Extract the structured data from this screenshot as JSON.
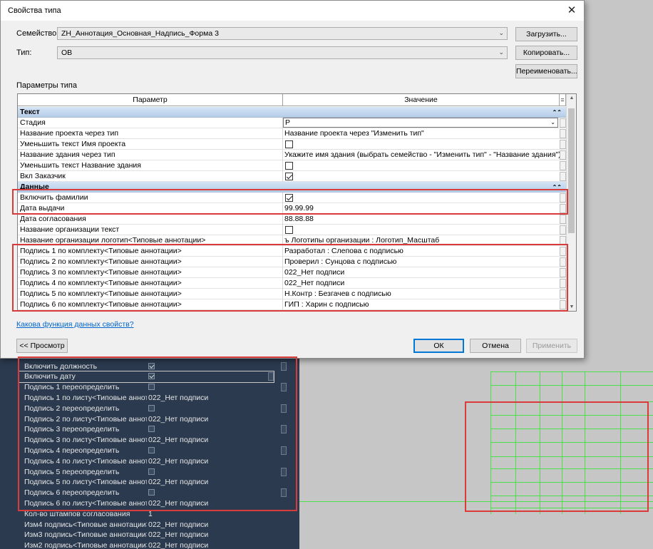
{
  "dialog": {
    "title": "Свойства типа",
    "close_label": "✕",
    "family_label": "Семейство:",
    "family_value": "ZH_Аннотация_Основная_Надпись_Форма 3",
    "type_label": "Тип:",
    "type_value": "ОВ",
    "load_button": "Загрузить...",
    "copy_button": "Копировать...",
    "rename_button": "Переименовать...",
    "type_params_label": "Параметры типа",
    "col_param": "Параметр",
    "col_value": "Значение",
    "col_extra": "=",
    "link_text": "Какова функция данных свойств?",
    "preview_button": "<< Просмотр",
    "ok_button": "ОК",
    "cancel_button": "Отмена",
    "apply_button": "Применить",
    "group_text": "Текст",
    "group_data": "Данные",
    "rows": [
      {
        "name": "Стадия",
        "value": "Р",
        "type": "select"
      },
      {
        "name": "Название проекта через тип",
        "value": "Название проекта через \"Изменить тип\"",
        "type": "text"
      },
      {
        "name": "Уменьшить текст Имя проекта",
        "value": "",
        "type": "check",
        "checked": false
      },
      {
        "name": "Название здания через тип",
        "value": "Укажите имя здания (выбрать семейство - \"Изменить тип\" - \"Название здания\")",
        "type": "text"
      },
      {
        "name": "Уменьшить текст Название здания",
        "value": "",
        "type": "check",
        "checked": false
      },
      {
        "name": "Вкл Заказчик",
        "value": "",
        "type": "check",
        "checked": true
      }
    ],
    "rows2": [
      {
        "name": "Включить фамилии",
        "value": "",
        "type": "check",
        "checked": true
      },
      {
        "name": "Дата выдачи",
        "value": "99.99.99",
        "type": "text"
      },
      {
        "name": "Дата согласования",
        "value": "88.88.88",
        "type": "text"
      },
      {
        "name": "Название организации текст",
        "value": "",
        "type": "check",
        "checked": false
      },
      {
        "name": "Название организации логотип<Типовые аннотации>",
        "value": "ъ Логотипы организации : Логотип_Масштаб",
        "type": "text"
      },
      {
        "name": "Подпись 1 по комплекту<Типовые аннотации>",
        "value": "Разработал : Слепова с подписью",
        "type": "text"
      },
      {
        "name": "Подпись 2 по комплекту<Типовые аннотации>",
        "value": "Проверил : Сунцова с подписью",
        "type": "text"
      },
      {
        "name": "Подпись 3 по комплекту<Типовые аннотации>",
        "value": "022_Нет подписи",
        "type": "text"
      },
      {
        "name": "Подпись 4 по комплекту<Типовые аннотации>",
        "value": "022_Нет подписи",
        "type": "text"
      },
      {
        "name": "Подпись 5 по комплекту<Типовые аннотации>",
        "value": "Н.Контр : Безгачев с подписью",
        "type": "text"
      },
      {
        "name": "Подпись 6 по комплекту<Типовые аннотации>",
        "value": "ГИП : Харин с подписью",
        "type": "text"
      }
    ]
  },
  "props_panel": {
    "rows": [
      {
        "name": "Включить должность",
        "value": "",
        "check": true,
        "checked": true
      },
      {
        "name": "Включить дату",
        "value": "",
        "check": true,
        "checked": true
      },
      {
        "name": "Подпись 1 переопределить",
        "value": "",
        "check": true,
        "checked": false
      },
      {
        "name": "Подпись 1 по листу<Типовые аннот...",
        "value": "022_Нет подписи",
        "check": false
      },
      {
        "name": "Подпись 2 переопределить",
        "value": "",
        "check": true,
        "checked": false
      },
      {
        "name": "Подпись 2 по листу<Типовые аннот...",
        "value": "022_Нет подписи",
        "check": false
      },
      {
        "name": "Подпись 3 переопределить",
        "value": "",
        "check": true,
        "checked": false
      },
      {
        "name": "Подпись 3 по листу<Типовые аннот...",
        "value": "022_Нет подписи",
        "check": false
      },
      {
        "name": "Подпись 4 переопределить",
        "value": "",
        "check": true,
        "checked": false
      },
      {
        "name": "Подпись 4 по листу<Типовые аннот...",
        "value": "022_Нет подписи",
        "check": false
      },
      {
        "name": "Подпись 5 переопределить",
        "value": "",
        "check": true,
        "checked": false
      },
      {
        "name": "Подпись 5 по листу<Типовые аннот...",
        "value": "022_Нет подписи",
        "check": false
      },
      {
        "name": "Подпись 6 переопределить",
        "value": "",
        "check": true,
        "checked": false
      },
      {
        "name": "Подпись 6 по листу<Типовые аннот...",
        "value": "022_Нет подписи",
        "check": false
      },
      {
        "name": "Кол-во штампов согласования",
        "value": "1",
        "check": false
      },
      {
        "name": "Изм4 подпись<Типовые аннотации>",
        "value": "022_Нет подписи",
        "check": false
      },
      {
        "name": "Изм3 подпись<Типовые аннотации>",
        "value": "022_Нет подписи",
        "check": false
      },
      {
        "name": "Изм2 подпись<Типовые аннотации>",
        "value": "022_Нет подписи",
        "check": false
      }
    ]
  },
  "colors": {
    "highlight": "#d93b3b",
    "cad_lines": "#4ce04c",
    "panel_bg": "#2b3a4f"
  }
}
